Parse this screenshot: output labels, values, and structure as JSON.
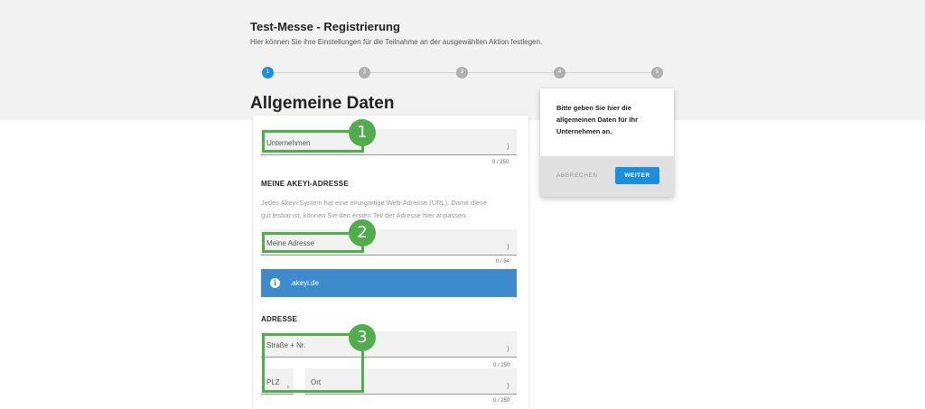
{
  "header": {
    "title": "Test-Messe - Registrierung",
    "subtitle": "Hier können Sie ihre Einstellungen für die Teilnahme an der ausgewählten Aktion festlegen."
  },
  "stepper": {
    "steps": [
      "1",
      "2",
      "3",
      "4",
      "5"
    ],
    "active_step": 1
  },
  "section": {
    "title": "Allgemeine Daten"
  },
  "form": {
    "company": {
      "placeholder": "Unternehmen",
      "counter": "0 / 250"
    },
    "url_section": {
      "title": "MEINE AKEYI-ADRESSE",
      "help_line1": "Jedes Akeyi-System hat eine einzigartige Web-Adresse (URL). Damit diese",
      "help_line2": "gut lesbar ist, können Sie den ersten Teil der Adresse hier anpassen."
    },
    "address_field": {
      "placeholder": "Meine Adresse",
      "counter": "0 / 64"
    },
    "domain_info": {
      "icon": "info-icon",
      "icon_glyph": "i",
      "text": ".akeyi.de"
    },
    "address_section": {
      "title": "ADRESSE"
    },
    "street": {
      "placeholder": "Straße + Nr.",
      "counter": "0 / 250"
    },
    "zip": {
      "placeholder": "PLZ"
    },
    "city": {
      "placeholder": "Ort",
      "counter": "0 / 250"
    }
  },
  "annotations": [
    "1",
    "2",
    "3"
  ],
  "dialog": {
    "text": "Bitte geben Sie hier die allgemeinen Daten für Ihr Unternehmen an.",
    "cancel_label": "ABBRECHEN",
    "next_label": "WEITER"
  },
  "colors": {
    "accent": "#1a8fdd",
    "info_bar": "#3d8bcd",
    "annotation": "#4fae4a"
  }
}
